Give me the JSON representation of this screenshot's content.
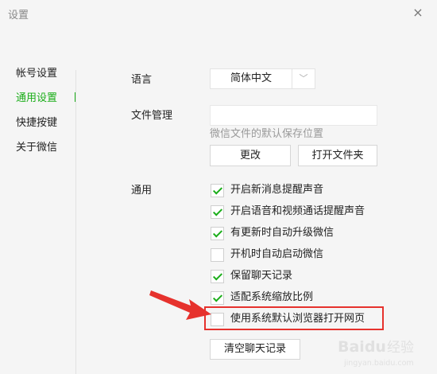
{
  "window": {
    "title": "设置",
    "close_label": "×"
  },
  "sidebar": {
    "items": [
      {
        "label": "帐号设置"
      },
      {
        "label": "通用设置"
      },
      {
        "label": "快捷按键"
      },
      {
        "label": "关于微信"
      }
    ]
  },
  "language": {
    "label": "语言",
    "value": "简体中文",
    "arrow": "﹀"
  },
  "file_management": {
    "label": "文件管理",
    "path_value": "",
    "hint": "微信文件的默认保存位置",
    "change_button": "更改",
    "open_folder_button": "打开文件夹"
  },
  "general": {
    "label": "通用",
    "options": [
      {
        "label": "开启新消息提醒声音",
        "checked": true
      },
      {
        "label": "开启语音和视频通话提醒声音",
        "checked": true
      },
      {
        "label": "有更新时自动升级微信",
        "checked": true
      },
      {
        "label": "开机时自动启动微信",
        "checked": false
      },
      {
        "label": "保留聊天记录",
        "checked": true
      },
      {
        "label": "适配系统缩放比例",
        "checked": true
      },
      {
        "label": "使用系统默认浏览器打开网页",
        "checked": false
      }
    ],
    "clear_history_button": "清空聊天记录"
  },
  "colors": {
    "accent": "#1aad19",
    "highlight": "#e6322d"
  },
  "watermark": {
    "text": "Baidu经验",
    "sub": "jingyan.baidu.com"
  }
}
